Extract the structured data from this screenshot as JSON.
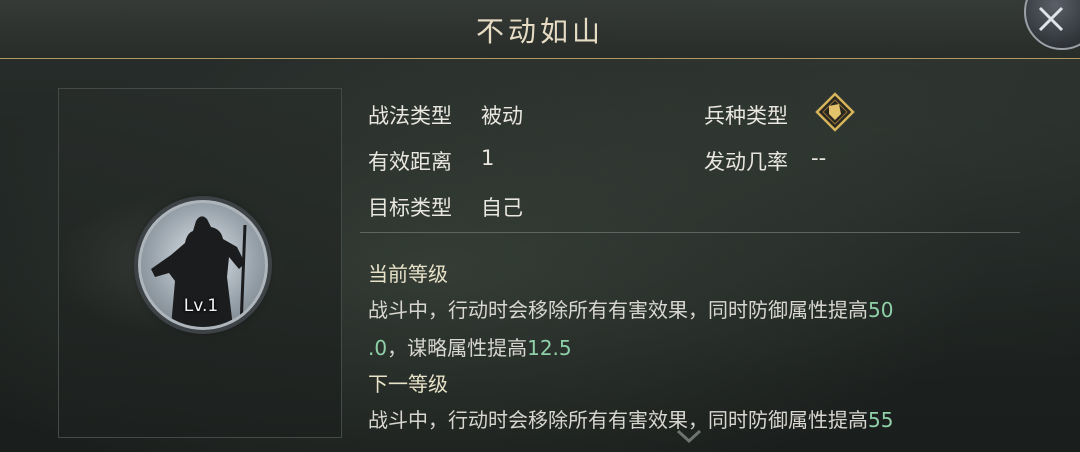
{
  "header": {
    "title": "不动如山"
  },
  "portrait": {
    "level_label": "Lv.1",
    "icon": "general-silhouette-icon"
  },
  "info": {
    "tactic_type": {
      "label": "战法类型",
      "value": "被动"
    },
    "troop_type": {
      "label": "兵种类型",
      "icon": "troop-type-icon"
    },
    "range": {
      "label": "有效距离",
      "value": "1"
    },
    "trigger_rate": {
      "label": "发动几率",
      "value": "--"
    },
    "target_type": {
      "label": "目标类型",
      "value": "自己"
    }
  },
  "current_level": {
    "heading": "当前等级",
    "line1_text": "战斗中，行动时会移除所有有害效果，同时防御属性提高",
    "line1_num": "50",
    "line2_num": ".0",
    "line2_text": "，谋略属性提高",
    "line2_num2": "12.5"
  },
  "next_level": {
    "heading": "下一等级",
    "line1_text": "战斗中，行动时会移除所有有害效果，同时防御属性提高",
    "line1_num": "55"
  },
  "colors": {
    "accent_gold": "#b59a5e",
    "number_green": "#8fd0a8",
    "text": "#e8e6df"
  }
}
